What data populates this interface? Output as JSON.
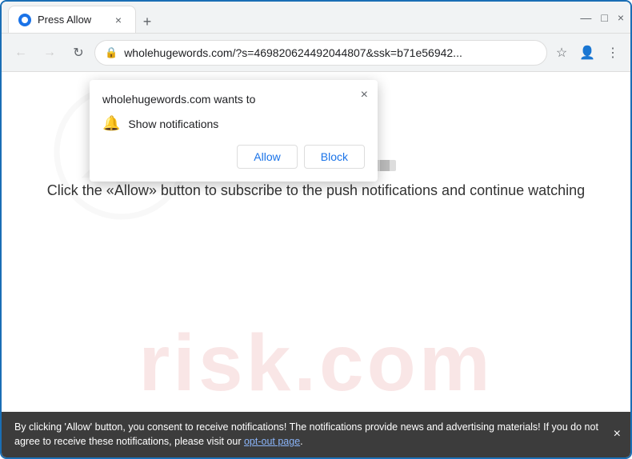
{
  "browser": {
    "tab": {
      "title": "Press Allow",
      "close_label": "×"
    },
    "new_tab_label": "+",
    "window_controls": {
      "minimize": "—",
      "maximize": "□",
      "close": "×"
    },
    "nav": {
      "back_label": "←",
      "forward_label": "→",
      "refresh_label": "↻",
      "address": "wholehugewords.com/?s=469820624492044807&ssk=b71e56942...",
      "star_label": "☆",
      "account_label": "👤",
      "menu_label": "⋮"
    }
  },
  "popup": {
    "title": "wholehugewords.com wants to",
    "notification_text": "Show notifications",
    "allow_label": "Allow",
    "block_label": "Block",
    "close_label": "×"
  },
  "page": {
    "main_text": "Click the «Allow» button to subscribe to the push notifications and continue watching",
    "watermark_text": "risk.com"
  },
  "bottom_bar": {
    "text": "By clicking 'Allow' button, you consent to receive notifications! The notifications provide news and advertising materials! If you do not agree to receive these notifications, please visit our ",
    "link_text": "opt-out page",
    "close_label": "×"
  }
}
